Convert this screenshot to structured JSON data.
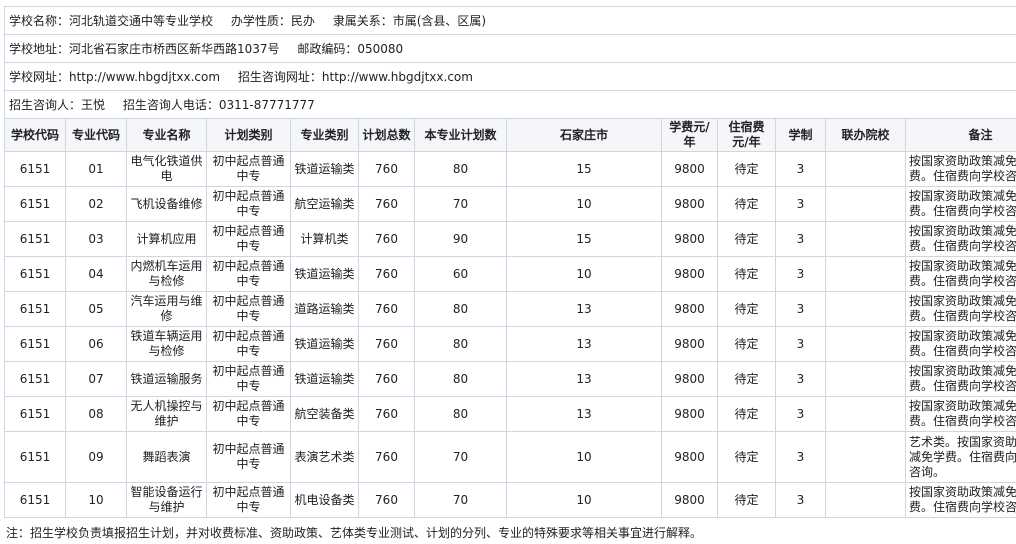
{
  "info": {
    "school_name": "学校名称：河北轨道交通中等专业学校",
    "school_type": "办学性质：民办",
    "affiliation": "隶属关系：市属(含县、区属)",
    "address": "学校地址：河北省石家庄市桥西区新华西路1037号",
    "postcode": "邮政编码：050080",
    "website": "学校网址：http://www.hbgdjtxx.com",
    "enroll_website": "招生咨询网址：http://www.hbgdjtxx.com",
    "contact": "招生咨询人：王悦",
    "phone": "招生咨询人电话：0311-87771777"
  },
  "table": {
    "headers": [
      "学校代码",
      "专业代码",
      "专业名称",
      "计划类别",
      "专业类别",
      "计划总数",
      "本专业计划数",
      "石家庄市",
      "学费元/年",
      "住宿费元/年",
      "学制",
      "联办院校",
      "备注"
    ],
    "rows": [
      {
        "school_code": "6151",
        "major_code": "01",
        "major": "电气化铁道供电",
        "plan_type": "初中起点普通中专",
        "category": "铁道运输类",
        "total": "760",
        "major_plan": "80",
        "sjz": "15",
        "tuition": "9800",
        "lodging": "待定",
        "years": "3",
        "partner": "",
        "note": "按国家资助政策减免学费。住宿费向学校咨询。"
      },
      {
        "school_code": "6151",
        "major_code": "02",
        "major": "飞机设备维修",
        "plan_type": "初中起点普通中专",
        "category": "航空运输类",
        "total": "760",
        "major_plan": "70",
        "sjz": "10",
        "tuition": "9800",
        "lodging": "待定",
        "years": "3",
        "partner": "",
        "note": "按国家资助政策减免学费。住宿费向学校咨询。"
      },
      {
        "school_code": "6151",
        "major_code": "03",
        "major": "计算机应用",
        "plan_type": "初中起点普通中专",
        "category": "计算机类",
        "total": "760",
        "major_plan": "90",
        "sjz": "15",
        "tuition": "9800",
        "lodging": "待定",
        "years": "3",
        "partner": "",
        "note": "按国家资助政策减免学费。住宿费向学校咨询。"
      },
      {
        "school_code": "6151",
        "major_code": "04",
        "major": "内燃机车运用与检修",
        "plan_type": "初中起点普通中专",
        "category": "铁道运输类",
        "total": "760",
        "major_plan": "60",
        "sjz": "10",
        "tuition": "9800",
        "lodging": "待定",
        "years": "3",
        "partner": "",
        "note": "按国家资助政策减免学费。住宿费向学校咨询。"
      },
      {
        "school_code": "6151",
        "major_code": "05",
        "major": "汽车运用与维修",
        "plan_type": "初中起点普通中专",
        "category": "道路运输类",
        "total": "760",
        "major_plan": "80",
        "sjz": "13",
        "tuition": "9800",
        "lodging": "待定",
        "years": "3",
        "partner": "",
        "note": "按国家资助政策减免学费。住宿费向学校咨询。"
      },
      {
        "school_code": "6151",
        "major_code": "06",
        "major": "铁道车辆运用与检修",
        "plan_type": "初中起点普通中专",
        "category": "铁道运输类",
        "total": "760",
        "major_plan": "80",
        "sjz": "13",
        "tuition": "9800",
        "lodging": "待定",
        "years": "3",
        "partner": "",
        "note": "按国家资助政策减免学费。住宿费向学校咨询。"
      },
      {
        "school_code": "6151",
        "major_code": "07",
        "major": "铁道运输服务",
        "plan_type": "初中起点普通中专",
        "category": "铁道运输类",
        "total": "760",
        "major_plan": "80",
        "sjz": "13",
        "tuition": "9800",
        "lodging": "待定",
        "years": "3",
        "partner": "",
        "note": "按国家资助政策减免学费。住宿费向学校咨询。"
      },
      {
        "school_code": "6151",
        "major_code": "08",
        "major": "无人机操控与维护",
        "plan_type": "初中起点普通中专",
        "category": "航空装备类",
        "total": "760",
        "major_plan": "80",
        "sjz": "13",
        "tuition": "9800",
        "lodging": "待定",
        "years": "3",
        "partner": "",
        "note": "按国家资助政策减免学费。住宿费向学校咨询。"
      },
      {
        "school_code": "6151",
        "major_code": "09",
        "major": "舞蹈表演",
        "plan_type": "初中起点普通中专",
        "category": "表演艺术类",
        "total": "760",
        "major_plan": "70",
        "sjz": "10",
        "tuition": "9800",
        "lodging": "待定",
        "years": "3",
        "partner": "",
        "note": "艺术类。按国家资助政策减免学费。住宿费向学校咨询。"
      },
      {
        "school_code": "6151",
        "major_code": "10",
        "major": "智能设备运行与维护",
        "plan_type": "初中起点普通中专",
        "category": "机电设备类",
        "total": "760",
        "major_plan": "70",
        "sjz": "10",
        "tuition": "9800",
        "lodging": "待定",
        "years": "3",
        "partner": "",
        "note": "按国家资助政策减免学费。住宿费向学校咨询。"
      }
    ]
  },
  "footnote": "注：招生学校负责填报招生计划，并对收费标准、资助政策、艺体类专业测试、计划的分列、专业的特殊要求等相关事宜进行解释。"
}
